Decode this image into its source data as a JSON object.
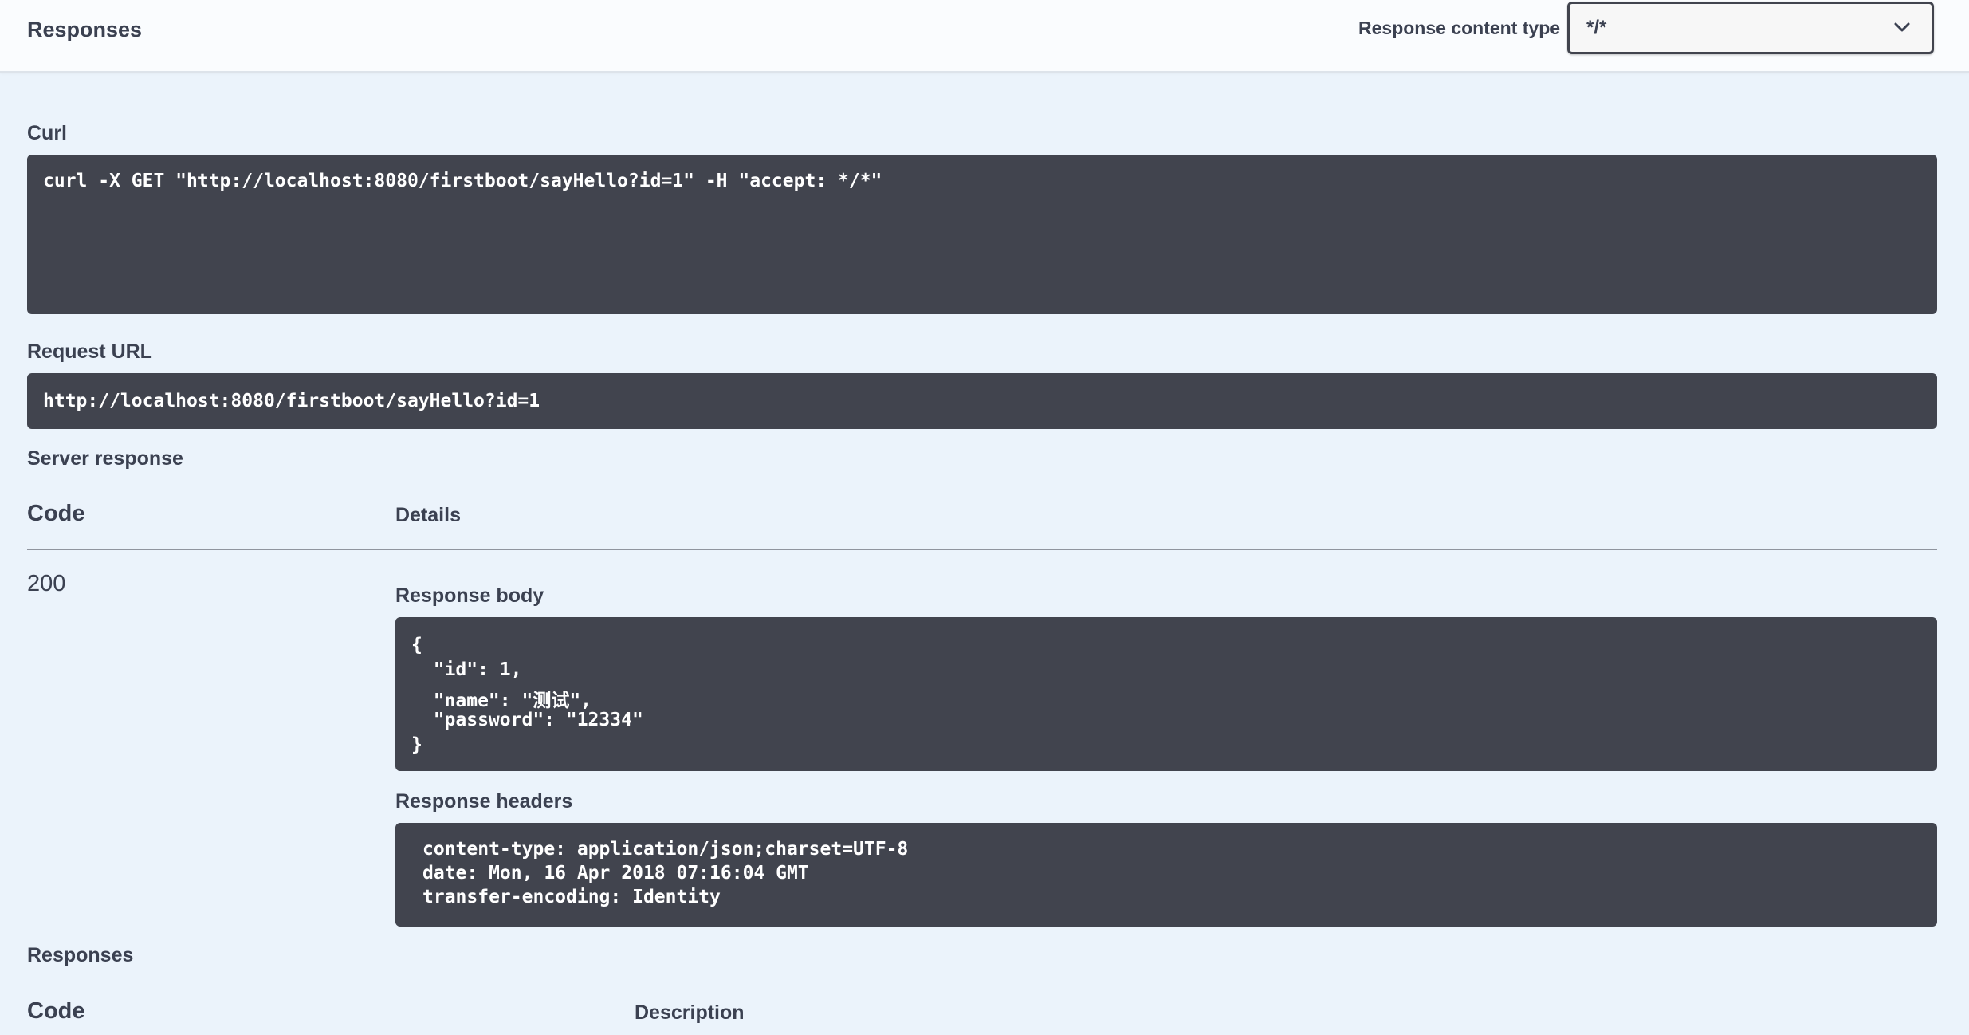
{
  "header": {
    "title": "Responses",
    "content_type_label": "Response content type",
    "content_type_value": "*/*"
  },
  "curl": {
    "label": "Curl",
    "command": "curl -X GET \"http://localhost:8080/firstboot/sayHello?id=1\" -H \"accept: */*\""
  },
  "request_url": {
    "label": "Request URL",
    "value": "http://localhost:8080/firstboot/sayHello?id=1"
  },
  "server_response": {
    "label": "Server response",
    "col_code": "Code",
    "col_details": "Details",
    "code": "200",
    "body_label": "Response body",
    "body_lines": [
      "{",
      "  \"id\": 1,",
      "  \"name\": \"测试\",",
      "  \"password\": \"12334\"",
      "}"
    ],
    "headers_label": "Response headers",
    "headers_lines": [
      "content-type: application/json;charset=UTF-8",
      "date: Mon, 16 Apr 2018 07:16:04 GMT",
      "transfer-encoding: Identity"
    ]
  },
  "responses": {
    "label": "Responses",
    "col_code": "Code",
    "col_description": "Description"
  },
  "icons": {
    "select_chevron": "chevron-down-icon"
  }
}
